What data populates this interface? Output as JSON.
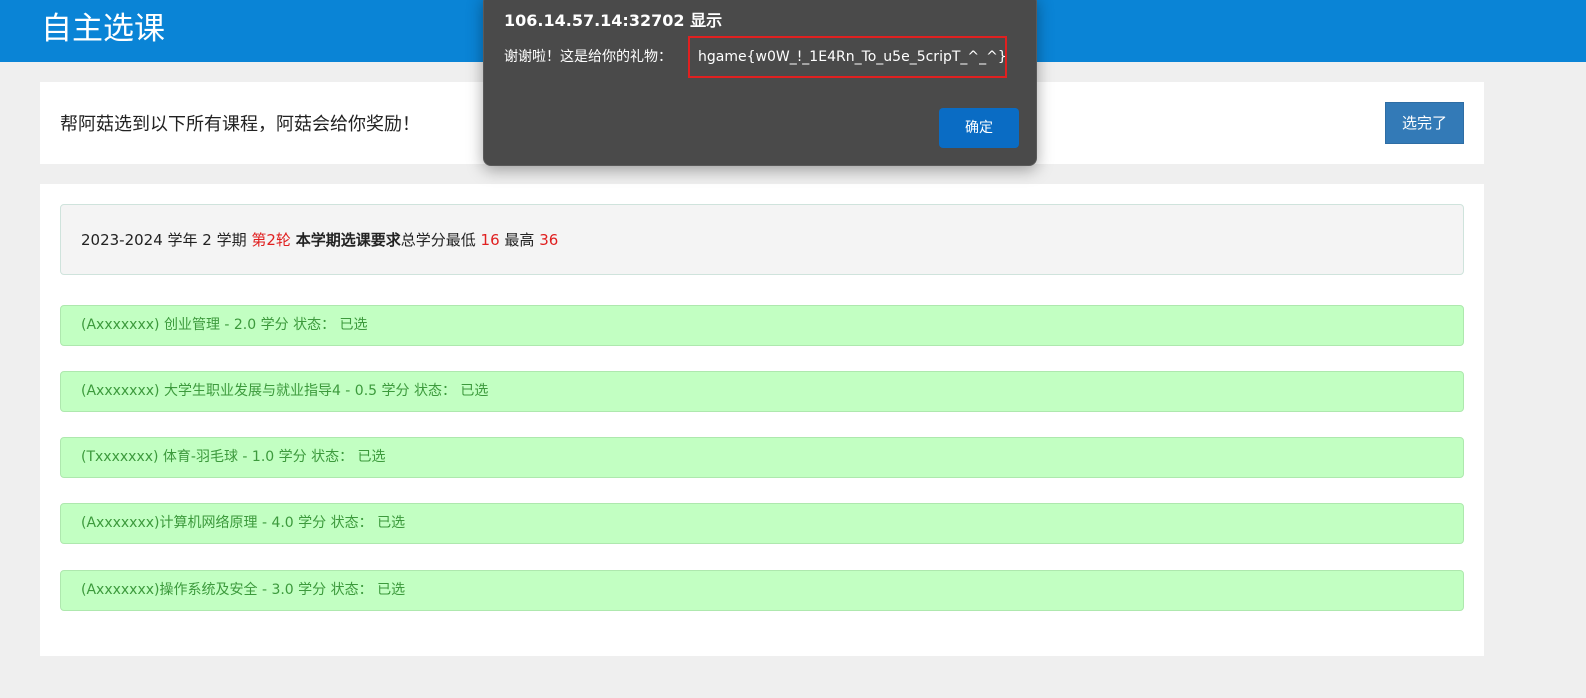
{
  "header": {
    "title": "自主选课"
  },
  "instruction": {
    "text": "帮阿菇选到以下所有课程，阿菇会给你奖励！",
    "done_button": "选完了"
  },
  "semester": {
    "year": "2023-2024 学年 2 学期",
    "round": "第2轮",
    "requirement_label": "本学期选课要求",
    "credit_text": "总学分最低",
    "min": "16",
    "max_label": "最高",
    "max": "36"
  },
  "courses": [
    {
      "text": "(Axxxxxxx) 创业管理 - 2.0 学分 状态： 已选"
    },
    {
      "text": "(Axxxxxxx) 大学生职业发展与就业指导4 - 0.5 学分 状态： 已选"
    },
    {
      "text": "(Txxxxxxx) 体育-羽毛球 - 1.0 学分 状态： 已选"
    },
    {
      "text": "(Axxxxxxx)计算机网络原理 - 4.0 学分 状态： 已选"
    },
    {
      "text": "(Axxxxxxx)操作系统及安全 - 3.0 学分 状态： 已选"
    }
  ],
  "dialog": {
    "title": "106.14.57.14:32702 显示",
    "message": "谢谢啦！这是给你的礼物：",
    "flag": "hgame{w0W_!_1E4Rn_To_u5e_5cripT_^_^}",
    "ok_button": "确定"
  },
  "colors": {
    "header_bg": "#0a84d6",
    "accent_red": "#e02020",
    "course_bg": "#c2ffc2",
    "course_text": "#3c9a3c",
    "button_blue": "#337ab7"
  }
}
